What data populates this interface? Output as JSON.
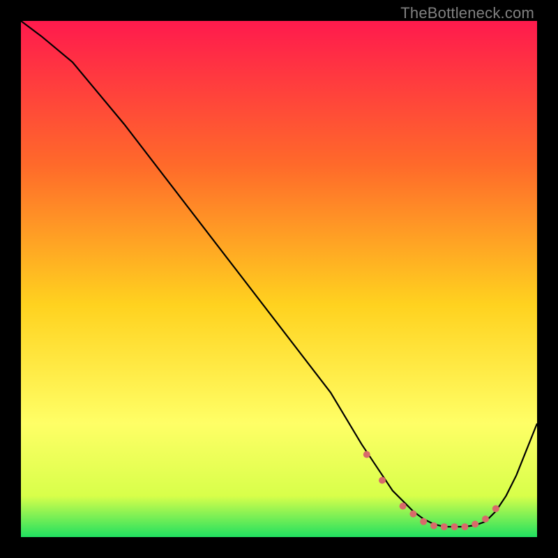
{
  "watermark": "TheBottleneck.com",
  "colors": {
    "bg_black": "#000000",
    "grad_top": "#ff1a4d",
    "grad_mid1": "#ff6a2a",
    "grad_mid2": "#ffd21f",
    "grad_mid3": "#ffff66",
    "grad_mid4": "#d8ff4a",
    "grad_bottom": "#20e060",
    "line": "#000000",
    "marker": "#d86a6a"
  },
  "chart_data": {
    "type": "line",
    "title": "",
    "xlabel": "",
    "ylabel": "",
    "xlim": [
      0,
      100
    ],
    "ylim": [
      0,
      100
    ],
    "series": [
      {
        "name": "curve",
        "x": [
          0,
          4,
          10,
          20,
          30,
          40,
          50,
          60,
          66,
          70,
          72,
          74,
          76,
          78,
          80,
          82,
          84,
          86,
          88,
          90,
          92,
          94,
          96,
          98,
          100
        ],
        "y": [
          100,
          97,
          92,
          80,
          67,
          54,
          41,
          28,
          18,
          12,
          9,
          7,
          5,
          3.5,
          2.5,
          2,
          2,
          2,
          2.3,
          3,
          5,
          8,
          12,
          17,
          22
        ]
      }
    ],
    "markers": {
      "name": "points",
      "x": [
        67,
        70,
        74,
        76,
        78,
        80,
        82,
        84,
        86,
        88,
        90,
        92
      ],
      "y": [
        16,
        11,
        6,
        4.5,
        3,
        2.2,
        2,
        2,
        2,
        2.5,
        3.5,
        5.5
      ]
    }
  }
}
